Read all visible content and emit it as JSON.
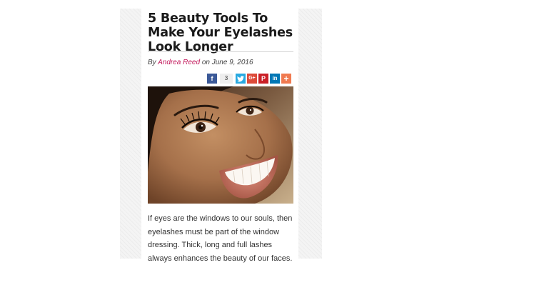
{
  "article": {
    "title": "5 Beauty Tools To Make Your Eyelashes Look Longer",
    "byline": {
      "prefix": "By",
      "author": "Andrea Reed",
      "date_prefix": "on",
      "date": "June 9, 2016"
    },
    "share": {
      "facebook_count": "3",
      "buttons": [
        {
          "name": "facebook",
          "glyph": "f",
          "color": "#3b5998"
        },
        {
          "name": "twitter",
          "glyph": "t",
          "color": "#29a9e0"
        },
        {
          "name": "google-plus",
          "glyph": "G+",
          "color": "#dd4b39"
        },
        {
          "name": "pinterest",
          "glyph": "P",
          "color": "#cb2027"
        },
        {
          "name": "linkedin",
          "glyph": "in",
          "color": "#0077b5"
        },
        {
          "name": "more",
          "glyph": "+",
          "color": "#f07a50"
        }
      ]
    },
    "image": {
      "subject": "smiling-woman-eyelashes-photo"
    },
    "intro": "If eyes are the windows to our souls, then eyelashes must be part of the window dressing. Thick, long and full lashes always enhances the beauty of our faces."
  },
  "colors": {
    "author_link": "#c2185b",
    "frame_background": "#f4f4f4",
    "title_text": "#1a1a1a"
  }
}
